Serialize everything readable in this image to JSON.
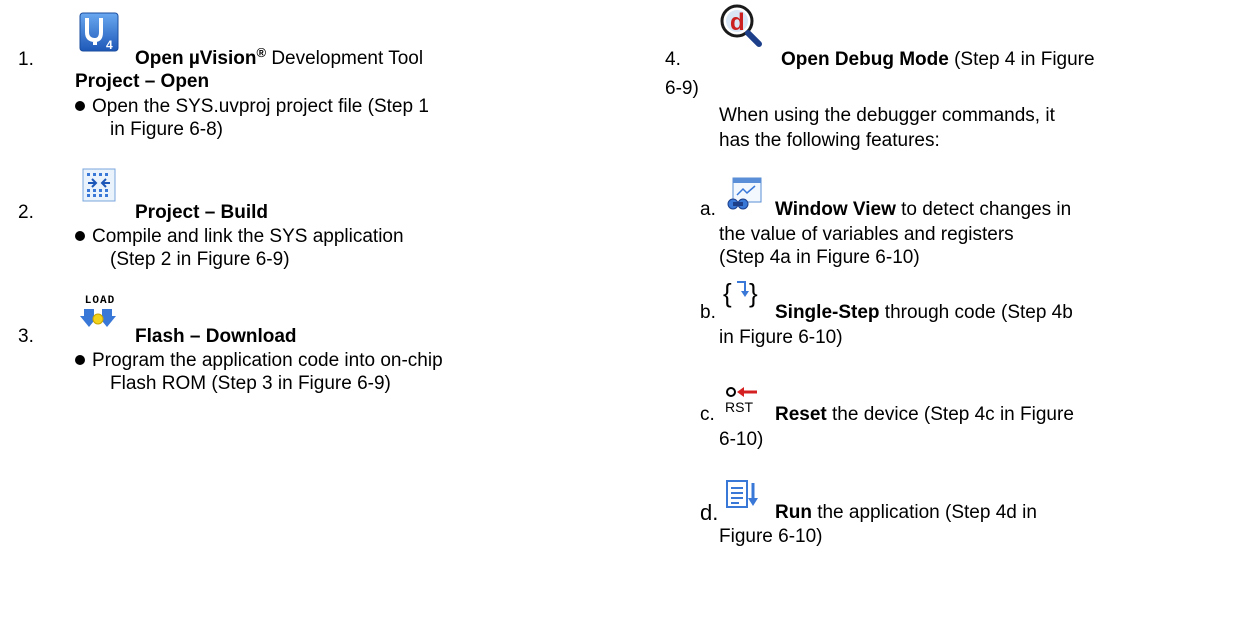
{
  "left": {
    "step1": {
      "num": "1.",
      "title_bold": "Open µVision",
      "title_sup": "®",
      "title_rest": " Development Tool",
      "subtitle": "Project – Open",
      "bullet_line1": "Open the SYS.uvproj project file (Step 1",
      "bullet_line2": "in Figure 6-8)",
      "icon": "uvision-logo-icon"
    },
    "step2": {
      "num": "2.",
      "title": "Project – Build",
      "bullet_line1": "Compile and link the SYS application",
      "bullet_line2": "(Step 2 in Figure 6-9)",
      "icon": "build-icon"
    },
    "step3": {
      "num": "3.",
      "title": "Flash – Download",
      "icon_text": "LOAD",
      "bullet_line1": "Program the application code into on-chip",
      "bullet_line2": "Flash ROM (Step 3 in Figure 6-9)",
      "icon": "flash-load-icon"
    }
  },
  "right": {
    "step4": {
      "num": "4.",
      "title_bold": "Open Debug Mode",
      "title_rest": " (Step 4 in Figure",
      "line2": "6-9)",
      "desc_line1": "When using the debugger commands, it",
      "desc_line2": "has the following features:",
      "icon": "debug-magnifier-icon"
    },
    "a": {
      "label": "a.",
      "bold": "Window View",
      "rest": " to detect changes in",
      "line2": "the value of variables and registers",
      "line3": "(Step 4a in Figure 6-10)",
      "icon": "watch-window-icon"
    },
    "b": {
      "label": "b.",
      "bold": "Single-Step",
      "rest": " through code (Step 4b",
      "line2": "in Figure 6-10)",
      "icon": "step-into-icon"
    },
    "c": {
      "label": "c.",
      "icon_text": "RST",
      "bold": "Reset",
      "rest": " the device (Step 4c in Figure",
      "line2": "6-10)",
      "icon": "reset-icon"
    },
    "d": {
      "label": "d.",
      "bold": "Run",
      "rest": " the application (Step 4d in",
      "line2": "Figure 6-10)",
      "icon": "run-icon"
    }
  },
  "colors": {
    "uvision_blue": "#2f6fcc",
    "debug_red": "#cc1f1f",
    "icon_blue": "#3a78d8",
    "reset_red": "#d42020"
  }
}
